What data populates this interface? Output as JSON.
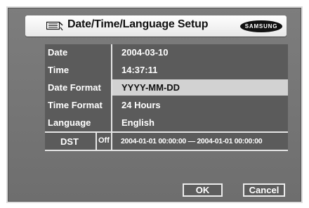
{
  "title_bar": {
    "icon": "keyboard-settings-icon",
    "title": "Date/Time/Language Setup",
    "logo_text": "SAMSUNG"
  },
  "settings": {
    "rows": [
      {
        "label": "Date",
        "value": "2004-03-10"
      },
      {
        "label": "Time",
        "value": "14:37:11"
      },
      {
        "label": "Date Format",
        "value": "YYYY-MM-DD"
      },
      {
        "label": "Time Format",
        "value": "24 Hours"
      },
      {
        "label": "Language",
        "value": "English"
      }
    ],
    "selected_row": "Date Format"
  },
  "dst": {
    "label": "DST",
    "state": "Off",
    "range": "2004-01-01 00:00:00  —  2004-01-01 00:00:00"
  },
  "buttons": {
    "ok": "OK",
    "cancel": "Cancel"
  },
  "colors": {
    "background": "#717171",
    "panel": "#5b5b5b",
    "highlight": "#d2d2d2",
    "border": "#e6e6e6"
  }
}
